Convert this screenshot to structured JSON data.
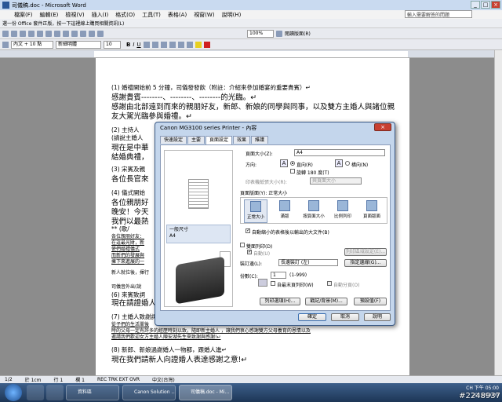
{
  "window": {
    "title": "司儀稿.doc - Microsoft Word"
  },
  "menu": [
    "檔案(F)",
    "編輯(E)",
    "檢視(V)",
    "插入(I)",
    "格式(O)",
    "工具(T)",
    "表格(A)",
    "視窗(W)",
    "說明(H)"
  ],
  "help_placeholder": "輸入需要解答的問題",
  "infobar": {
    "text": "選一份 Office 套件正版，按一下這裡線上購買相關資訊(L)"
  },
  "toolbar": {
    "zoom": "100%",
    "reading": "閱讀版面(R)"
  },
  "format_toolbar": {
    "style": "內文 + 10 點",
    "font": "新細明體",
    "size": "10"
  },
  "document": {
    "lines": [
      "(1) 婚禮開始前 5 分鐘，司儀發發飲（附註：介紹來參加婚宴的重要貴賓）↵",
      "感謝貴賓--------、--------、--------的光臨。↵",
      "感謝由北部遠到而來的親朋好友，新郎、新娘的同學與同事，以及雙方主婚人與諸位親",
      "友大駕光臨參與婚禮。↵",
      "(2) 主持人",
      "(請說主婚人",
      "現在是中華",
      "結婚典禮，",
      "(3) 宋賓及親",
      "各位長官來",
      "(4) 儀式開始",
      "各位親朋好",
      "晚安！今天",
      "我們以最熱",
      "** (歌/",
      "各位親朋好友：",
      "在這最光財，新",
      "使們婚禮儀式",
      "而新們的發展與",
      "擁下來進展的一",
      "新人就位後，揮行",
      "司儀音外出(說",
      "(6) 來賓致詞",
      "現在請證婚人",
      "(7) 主婚人致謝詞",
      "從子們的生活單後",
      "時的父母一定有許多的經歷時刻以致，隨即新主婚人 ，讓我們衷心感謝雙方父母養育的恩情以及",
      "邀請我們歡迎女方主婚人陳安湖先生來致謝與感謝!↵",
      "(8) 新郎、新娘過謝婚人一物都，跟婚人進↵",
      "現在我們請新人向證婚人表達感謝之意!↵"
    ]
  },
  "status": {
    "page": "1/2",
    "pos": "於 1cm",
    "line": "行 1",
    "col": "欄 1",
    "modes": "REC TRK EXT OVR",
    "lang": "中文(台灣)"
  },
  "taskbar": {
    "items": [
      "資料區",
      "Canon Solution ...",
      "司儀稿.doc - Mi..."
    ],
    "ime": "CH",
    "time": "下午 05:00",
    "date": "2013/09/09",
    "watermark": "#2248937"
  },
  "dialog": {
    "title": "Canon MG3100 series Printer - 內容",
    "tabs": [
      "快速設定",
      "主要",
      "頁面設定",
      "效果",
      "維護"
    ],
    "preview_label": "一般尺寸\nA4",
    "page_size_label": "頁面大小(Z):",
    "page_size_value": "A4",
    "orientation_label": "方向:",
    "portrait": "直向(R)",
    "landscape": "橫向(N)",
    "rotate180": "旋轉 180 度(T)",
    "printer_paper_label": "印表機紙張大小(R):",
    "printer_paper_value": "與頁面大小",
    "layout_label": "頁面版面(Y):  正常大小",
    "layouts": [
      "正常大小",
      "滿版",
      "按頁面大小",
      "比例列印",
      "頁面版面"
    ],
    "fit_check": "自動縮小的表格後以輸出的大文件(B)",
    "duplex": "雙面列印(D)",
    "auto": "自動(U)",
    "print_area_btn": "列印區域設定(E)...",
    "staple_label": "裝訂邊(L):",
    "staple_value": "長邊裝訂 (左)",
    "margin_btn": "指定邊緣(G)...",
    "copies_label": "份數(C):",
    "copies_value": "1",
    "copies_range": "(1-999)",
    "last_first": "自最末頁列印(W)",
    "collate": "自動分頁(O)",
    "print_options_btn": "列印選項(H)...",
    "stamp_btn": "戳記/背景(M)...",
    "defaults_btn": "預設值(F)",
    "ok": "確定",
    "cancel": "取消",
    "help": "說明"
  }
}
